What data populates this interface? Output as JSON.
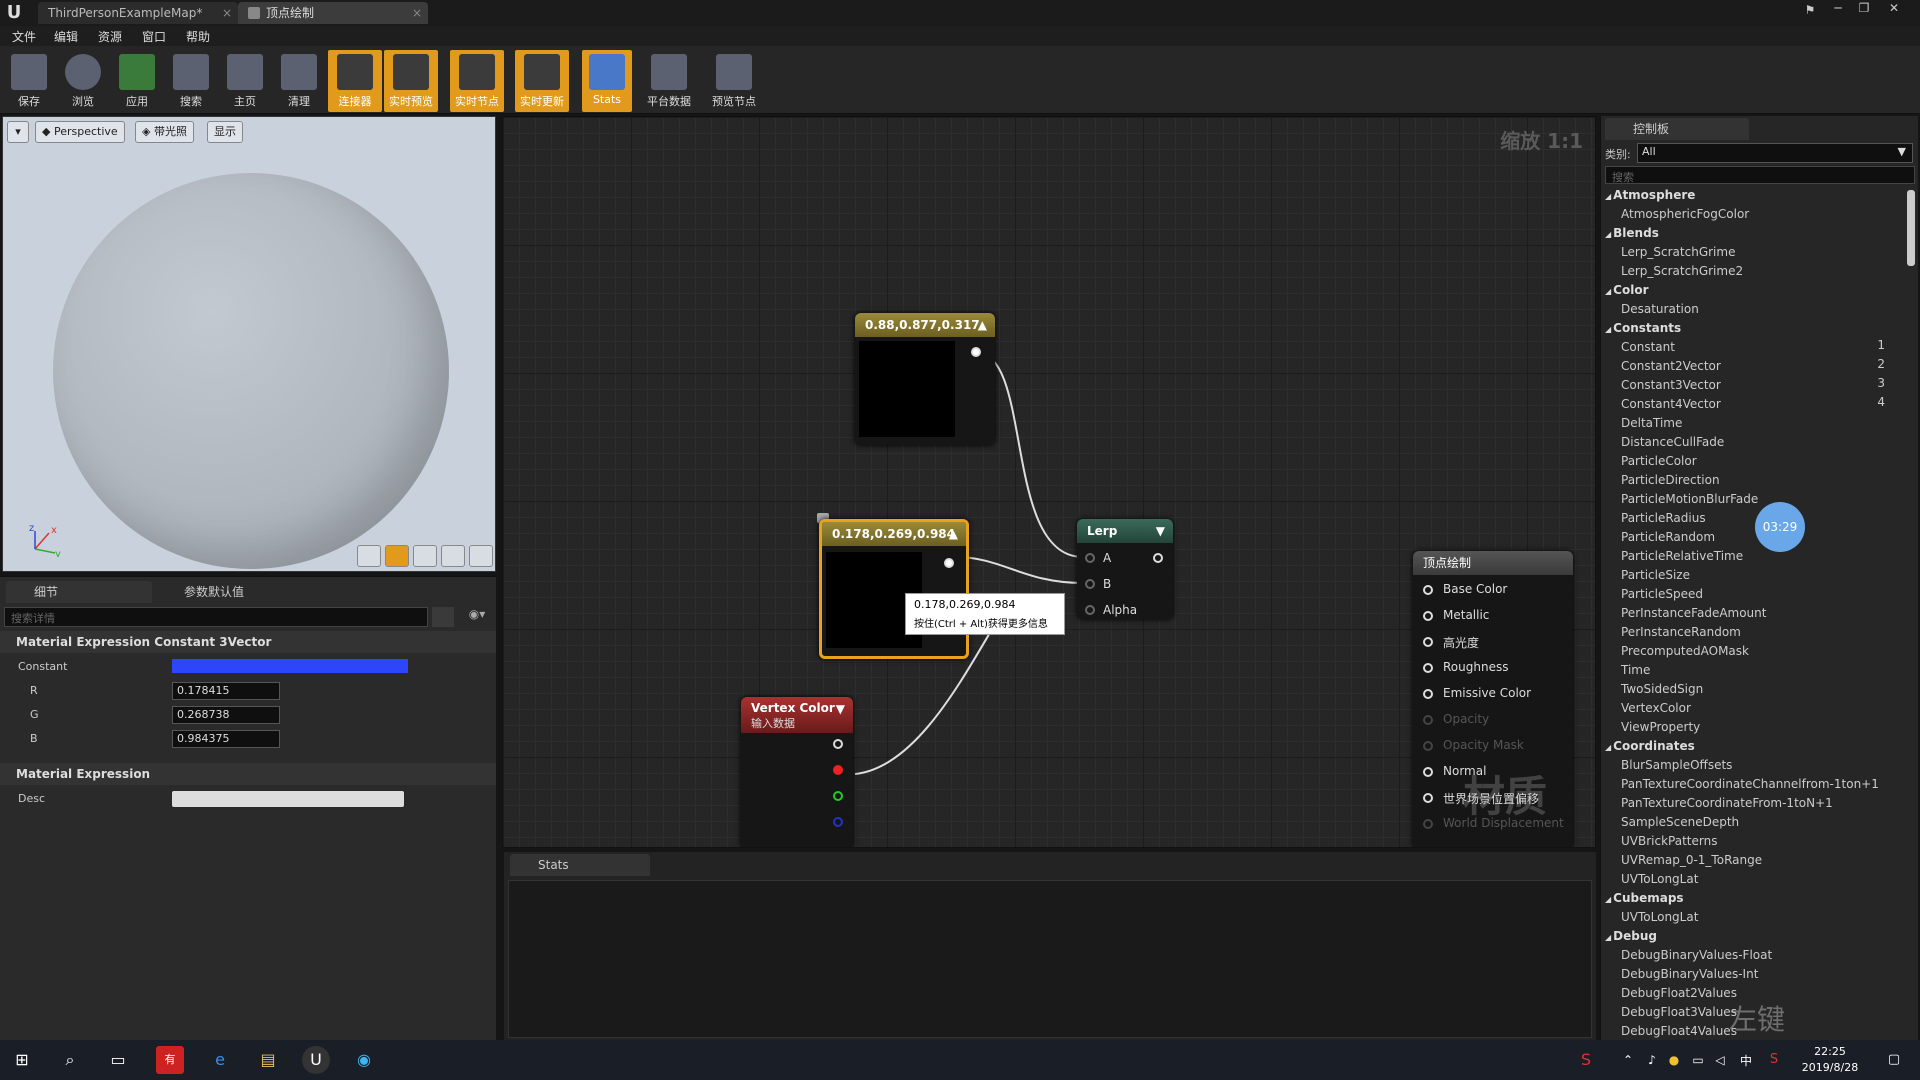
{
  "titlebar": {
    "tabs": [
      "ThirdPersonExampleMap*",
      "顶点绘制"
    ]
  },
  "menu": [
    "文件",
    "编辑",
    "资源",
    "窗口",
    "帮助"
  ],
  "toolbar": [
    {
      "label": "保存",
      "icon": "save-icon",
      "active": false
    },
    {
      "label": "浏览",
      "icon": "browse-icon",
      "active": false
    },
    {
      "label": "应用",
      "icon": "apply-icon",
      "active": false
    },
    {
      "label": "搜索",
      "icon": "search-icon",
      "active": false
    },
    {
      "label": "主页",
      "icon": "home-icon",
      "active": false
    },
    {
      "label": "清理",
      "icon": "clean-icon",
      "active": false
    },
    {
      "label": "连接器",
      "icon": "connector-icon",
      "active": true
    },
    {
      "label": "实时预览",
      "icon": "live-preview-icon",
      "active": true
    },
    {
      "label": "实时节点",
      "icon": "live-nodes-icon",
      "active": true
    },
    {
      "label": "实时更新",
      "icon": "live-update-icon",
      "active": true
    },
    {
      "label": "Stats",
      "icon": "stats-icon",
      "active": true
    },
    {
      "label": "平台数据",
      "icon": "platform-stats-icon",
      "active": false
    },
    {
      "label": "预览节点",
      "icon": "preview-node-icon",
      "active": false
    }
  ],
  "viewport": {
    "perspective": "Perspective",
    "lit": "带光照",
    "show": "显示"
  },
  "details": {
    "tab_details": "细节",
    "tab_params": "参数默认值",
    "search_placeholder": "搜索详情",
    "section1": "Material Expression Constant 3Vector",
    "constant_label": "Constant",
    "constant_color": "#2d45fb",
    "r_label": "R",
    "r_value": "0.178415",
    "g_label": "G",
    "g_value": "0.268738",
    "b_label": "B",
    "b_value": "0.984375",
    "section2": "Material Expression",
    "desc_label": "Desc"
  },
  "graph": {
    "zoom": "缩放 1:1",
    "node1_title": "0.88,0.877,0.317",
    "node2_title": "0.178,0.269,0.984",
    "tooltip_line1": "0.178,0.269,0.984",
    "tooltip_line2": "按住(Ctrl + Alt)获得更多信息",
    "lerp_title": "Lerp",
    "lerp_a": "A",
    "lerp_b": "B",
    "lerp_alpha": "Alpha",
    "vc_title": "Vertex Color",
    "vc_sub": "输入数据",
    "result_title": "顶点绘制",
    "result_pins": [
      "Base Color",
      "Metallic",
      "高光度",
      "Roughness",
      "Emissive Color",
      "Opacity",
      "Opacity Mask",
      "Normal",
      "世界场景位置偏移",
      "World Displacement"
    ],
    "watermark": "材质"
  },
  "stats": {
    "tab": "Stats"
  },
  "palette": {
    "tab": "控制板",
    "category_label": "类别:",
    "category_value": "All",
    "search_placeholder": "搜索",
    "timer": "03:29",
    "entries": [
      {
        "t": "cat",
        "text": "Atmosphere"
      },
      {
        "t": "item",
        "text": "AtmosphericFogColor"
      },
      {
        "t": "cat",
        "text": "Blends"
      },
      {
        "t": "item",
        "text": "Lerp_ScratchGrime"
      },
      {
        "t": "item",
        "text": "Lerp_ScratchGrime2"
      },
      {
        "t": "cat",
        "text": "Color"
      },
      {
        "t": "item",
        "text": "Desaturation"
      },
      {
        "t": "cat",
        "text": "Constants"
      },
      {
        "t": "item",
        "text": "Constant",
        "num": "1"
      },
      {
        "t": "item",
        "text": "Constant2Vector",
        "num": "2"
      },
      {
        "t": "item",
        "text": "Constant3Vector",
        "num": "3"
      },
      {
        "t": "item",
        "text": "Constant4Vector",
        "num": "4"
      },
      {
        "t": "item",
        "text": "DeltaTime"
      },
      {
        "t": "item",
        "text": "DistanceCullFade"
      },
      {
        "t": "item",
        "text": "ParticleColor"
      },
      {
        "t": "item",
        "text": "ParticleDirection"
      },
      {
        "t": "item",
        "text": "ParticleMotionBlurFade"
      },
      {
        "t": "item",
        "text": "ParticleRadius"
      },
      {
        "t": "item",
        "text": "ParticleRandom"
      },
      {
        "t": "item",
        "text": "ParticleRelativeTime"
      },
      {
        "t": "item",
        "text": "ParticleSize"
      },
      {
        "t": "item",
        "text": "ParticleSpeed"
      },
      {
        "t": "item",
        "text": "PerInstanceFadeAmount"
      },
      {
        "t": "item",
        "text": "PerInstanceRandom"
      },
      {
        "t": "item",
        "text": "PrecomputedAOMask"
      },
      {
        "t": "item",
        "text": "Time"
      },
      {
        "t": "item",
        "text": "TwoSidedSign"
      },
      {
        "t": "item",
        "text": "VertexColor"
      },
      {
        "t": "item",
        "text": "ViewProperty"
      },
      {
        "t": "cat",
        "text": "Coordinates"
      },
      {
        "t": "item",
        "text": "BlurSampleOffsets"
      },
      {
        "t": "item",
        "text": "PanTextureCoordinateChannelfrom-1ton+1"
      },
      {
        "t": "item",
        "text": "PanTextureCoordinateFrom-1toN+1"
      },
      {
        "t": "item",
        "text": "SampleSceneDepth"
      },
      {
        "t": "item",
        "text": "UVBrickPatterns"
      },
      {
        "t": "item",
        "text": "UVRemap_0-1_ToRange"
      },
      {
        "t": "item",
        "text": "UVToLongLat"
      },
      {
        "t": "cat",
        "text": "Cubemaps"
      },
      {
        "t": "item",
        "text": "UVToLongLat"
      },
      {
        "t": "cat",
        "text": "Debug"
      },
      {
        "t": "item",
        "text": "DebugBinaryValues-Float"
      },
      {
        "t": "item",
        "text": "DebugBinaryValues-Int"
      },
      {
        "t": "item",
        "text": "DebugFloat2Values"
      },
      {
        "t": "item",
        "text": "DebugFloat3Values"
      },
      {
        "t": "item",
        "text": "DebugFloat4Values"
      }
    ],
    "overlay_text": "左键"
  },
  "taskbar": {
    "time": "22:25",
    "date": "2019/8/28",
    "ime": "中"
  }
}
